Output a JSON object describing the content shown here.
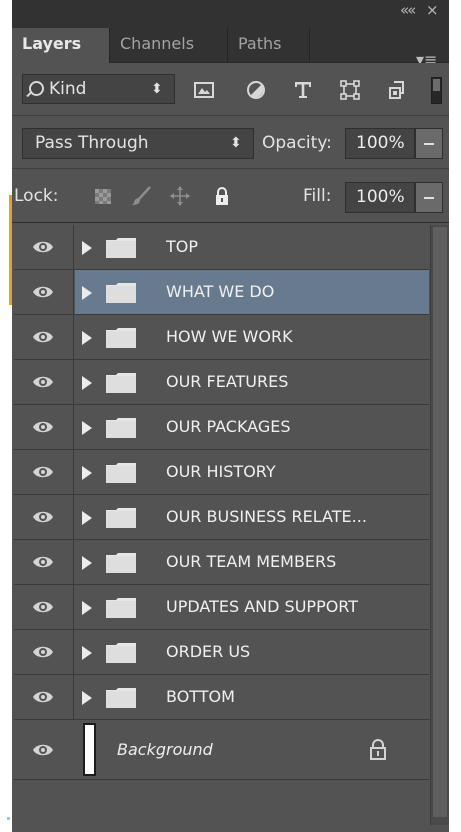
{
  "panel": {
    "collapse_glyph": "««",
    "close_glyph": "×",
    "menu_glyph": "▾≡"
  },
  "tabs": [
    {
      "label": "Layers",
      "active": true
    },
    {
      "label": "Channels",
      "active": false
    },
    {
      "label": "Paths",
      "active": false
    }
  ],
  "filter": {
    "kind_label": "Kind",
    "kind_arrows": "⬍",
    "icons": [
      "pixel-layer-filter-icon",
      "adjustment-layer-filter-icon",
      "type-layer-filter-icon",
      "shape-layer-filter-icon",
      "smart-object-filter-icon"
    ],
    "type_glyph": "T"
  },
  "blend": {
    "mode": "Pass Through",
    "mode_arrows": "⬍",
    "opacity_label": "Opacity:",
    "opacity_value": "100%"
  },
  "lock": {
    "label": "Lock:",
    "fill_label": "Fill:",
    "fill_value": "100%"
  },
  "layers": [
    {
      "name": "TOP",
      "selected": false
    },
    {
      "name": "WHAT WE DO",
      "selected": true
    },
    {
      "name": "HOW WE WORK",
      "selected": false
    },
    {
      "name": "OUR FEATURES",
      "selected": false
    },
    {
      "name": "OUR PACKAGES",
      "selected": false
    },
    {
      "name": "OUR HISTORY",
      "selected": false
    },
    {
      "name": "OUR BUSINESS RELATE...",
      "selected": false
    },
    {
      "name": "OUR TEAM MEMBERS",
      "selected": false
    },
    {
      "name": "UPDATES AND SUPPORT",
      "selected": false
    },
    {
      "name": "ORDER US",
      "selected": false
    },
    {
      "name": "BOTTOM",
      "selected": false
    }
  ],
  "background_layer": {
    "name": "Background",
    "locked": true
  },
  "colors": {
    "panel_bg": "#535353",
    "header_bg": "#323232",
    "selected_row": "#687b8e",
    "accent_orange": "#e8a317",
    "text": "#f0f0f0"
  }
}
